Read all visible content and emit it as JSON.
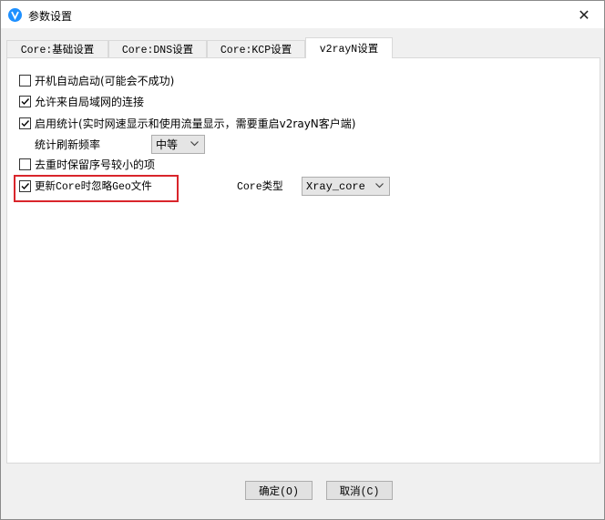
{
  "window": {
    "title": "参数设置",
    "close_symbol": "✕"
  },
  "tabs": [
    {
      "label": "Core:基础设置",
      "active": false
    },
    {
      "label": "Core:DNS设置",
      "active": false
    },
    {
      "label": "Core:KCP设置",
      "active": false
    },
    {
      "label": "v2rayN设置",
      "active": true
    }
  ],
  "options": {
    "autostart": {
      "label": "开机自动启动(可能会不成功)",
      "checked": false
    },
    "allow_lan": {
      "label": "允许来自局域网的连接",
      "checked": true
    },
    "enable_stats": {
      "label": "启用统计(实时网速显示和使用流量显示，需要重启v2rayN客户端)",
      "checked": true
    },
    "stats_freq": {
      "label": "统计刷新频率",
      "value": "中等"
    },
    "dedupe": {
      "label": "去重时保留序号较小的项",
      "checked": false
    },
    "ignore_geo": {
      "label": "更新Core时忽略Geo文件",
      "checked": true
    },
    "core_type": {
      "label": "Core类型",
      "value": "Xray_core"
    }
  },
  "buttons": {
    "ok": "确定(O)",
    "cancel": "取消(C)"
  },
  "colors": {
    "highlight": "#d9252b",
    "app_icon": "#1e90ff"
  },
  "icons": {
    "app": "v2rayn-logo-icon",
    "checkbox_check": "check-icon",
    "dropdown": "chevron-down-icon",
    "close": "close-icon"
  }
}
